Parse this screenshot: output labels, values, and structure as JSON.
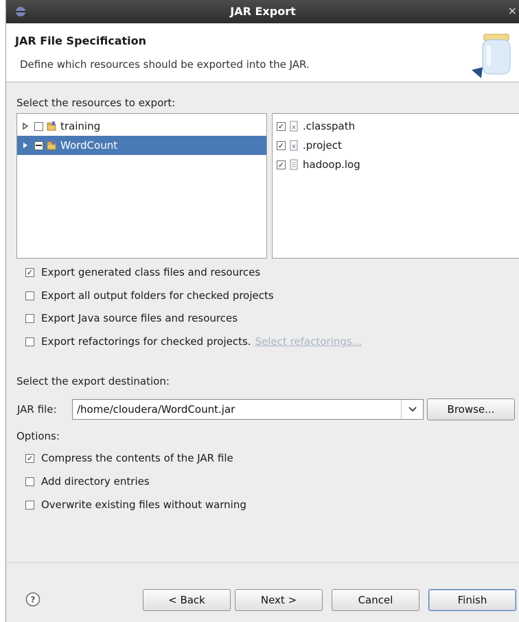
{
  "window": {
    "title": "JAR Export",
    "close_glyph": "×"
  },
  "header": {
    "title": "JAR File Specification",
    "description": "Define which resources should be exported into the JAR."
  },
  "resources": {
    "label": "Select the resources to export:",
    "projects": [
      {
        "label": "training",
        "checked": false,
        "selected": false
      },
      {
        "label": "WordCount",
        "checked": "partial",
        "selected": true
      }
    ],
    "files": [
      {
        "label": ".classpath",
        "checked": true,
        "icon": "xml-file-icon"
      },
      {
        "label": ".project",
        "checked": true,
        "icon": "xml-file-icon"
      },
      {
        "label": "hadoop.log",
        "checked": true,
        "icon": "text-file-icon"
      }
    ]
  },
  "export_options": [
    {
      "label": "Export generated class files and resources",
      "checked": true
    },
    {
      "label": "Export all output folders for checked projects",
      "checked": false
    },
    {
      "label": "Export Java source files and resources",
      "checked": false
    },
    {
      "label": "Export refactorings for checked projects.",
      "checked": false
    }
  ],
  "select_refactorings_link": "Select refactorings...",
  "destination": {
    "label": "Select the export destination:",
    "jar_label": "JAR file:",
    "jar_value": "/home/cloudera/WordCount.jar",
    "browse_label": "Browse..."
  },
  "options": {
    "label": "Options:",
    "items": [
      {
        "label": "Compress the contents of the JAR file",
        "checked": true
      },
      {
        "label": "Add directory entries",
        "checked": false
      },
      {
        "label": "Overwrite existing files without warning",
        "checked": false
      }
    ]
  },
  "buttons": {
    "back": "< Back",
    "next": "Next >",
    "cancel": "Cancel",
    "finish": "Finish"
  },
  "check_glyph": "✓",
  "colors": {
    "selection": "#4a7ab5",
    "titlebar": "#3a3a3a",
    "link_disabled": "#a8b4c4"
  }
}
